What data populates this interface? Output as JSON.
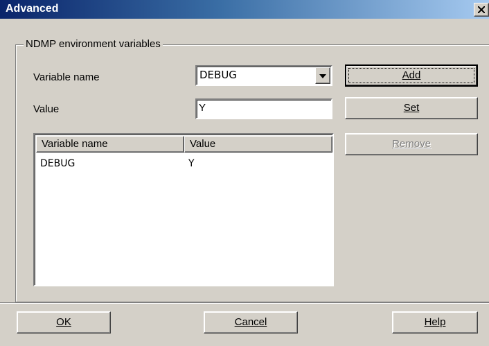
{
  "window": {
    "title": "Advanced"
  },
  "group": {
    "label": "NDMP environment variables"
  },
  "form": {
    "variable_name_label": "Variable name",
    "variable_name_value": "DEBUG",
    "value_label": "Value",
    "value_value": "Y"
  },
  "buttons": {
    "add": "Add",
    "set": "Set",
    "remove": "Remove",
    "ok": "OK",
    "cancel": "Cancel",
    "help": "Help"
  },
  "table": {
    "columns": [
      "Variable name",
      "Value"
    ],
    "rows": [
      [
        "DEBUG",
        "Y"
      ]
    ]
  }
}
